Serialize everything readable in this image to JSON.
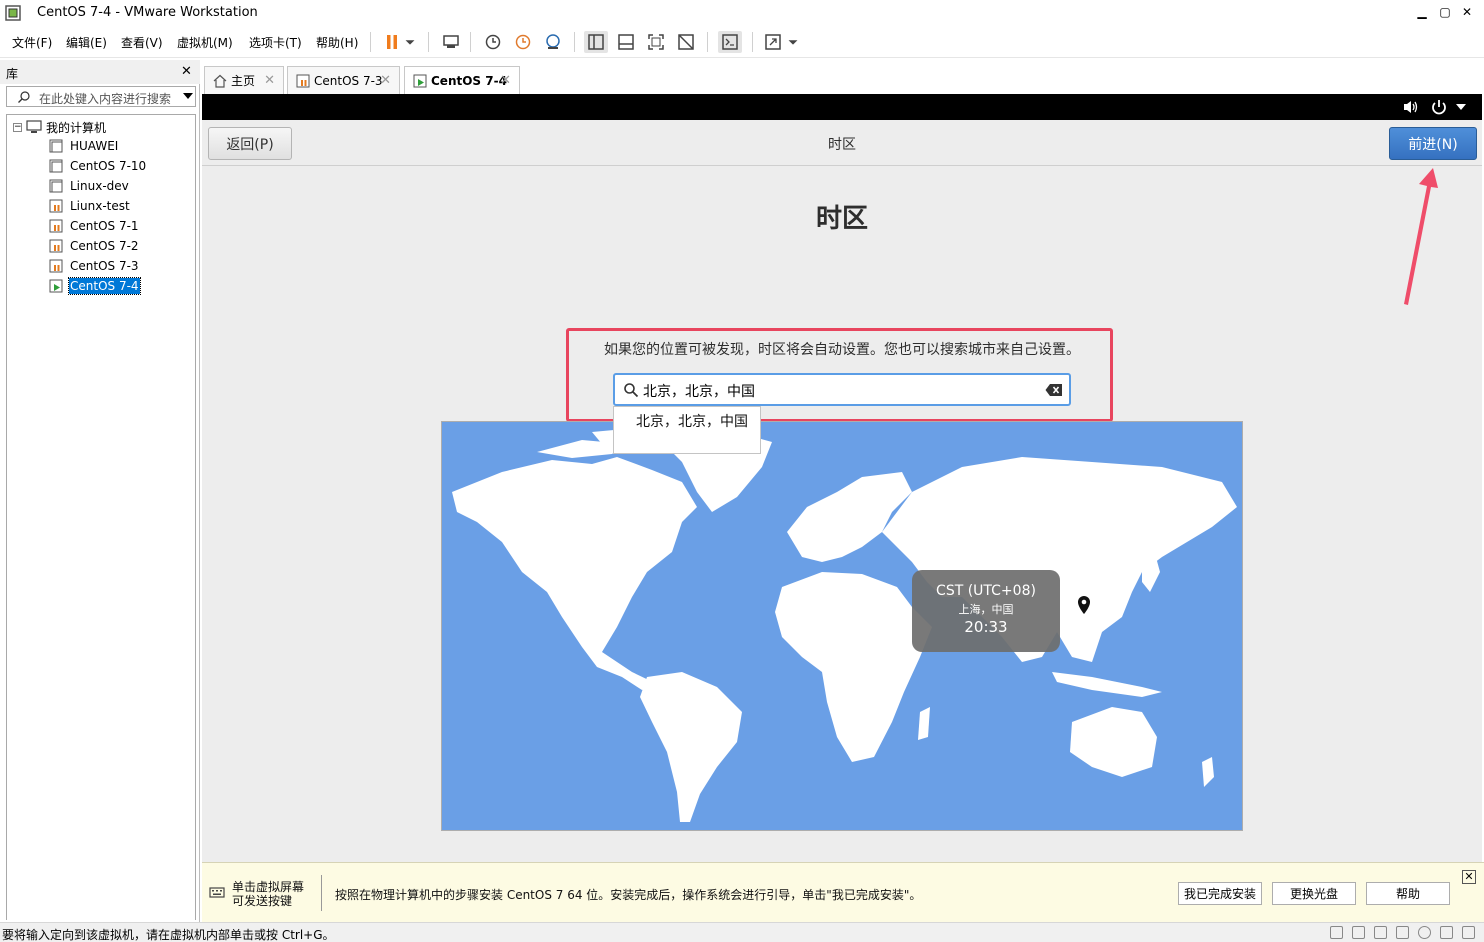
{
  "window": {
    "title": "CentOS 7-4 - VMware Workstation",
    "minimize": "▁",
    "maximize": "▢",
    "close": "✕"
  },
  "menu": [
    "文件(F)",
    "编辑(E)",
    "查看(V)",
    "虚拟机(M)",
    "选项卡(T)",
    "帮助(H)"
  ],
  "toolbar_icons": [
    "pause-icon",
    "dropdown-icon",
    "send-ctrl-alt-del-icon",
    "snapshot-icon",
    "revert-snapshot-icon",
    "snapshot-manager-icon",
    "sidebar-view-icon",
    "thumbnail-view-icon",
    "fullscreen-icon",
    "unity-icon",
    "console-icon",
    "stretch-icon"
  ],
  "library": {
    "title": "库",
    "close": "✕",
    "search_placeholder": "在此处键入内容进行搜索",
    "root": "我的计算机",
    "items": [
      "HUAWEI",
      "CentOS 7-10",
      "Linux-dev",
      "Liunx-test",
      "CentOS 7-1",
      "CentOS 7-2",
      "CentOS 7-3",
      "CentOS 7-4"
    ],
    "selected": "CentOS 7-4"
  },
  "tabs": [
    {
      "label": "主页",
      "close": "✕"
    },
    {
      "label": "CentOS 7-3",
      "close": "✕"
    },
    {
      "label": "CentOS 7-4",
      "close": "✕"
    }
  ],
  "installer": {
    "back": "返回(P)",
    "header_title": "时区",
    "next": "前进(N)",
    "page_title": "时区",
    "hint": "如果您的位置可被发现，时区将会自动设置。您也可以搜索城市来自己设置。",
    "search_value": "北京，北京，中国",
    "suggestion": "北京，北京，中国",
    "tooltip": {
      "tz": "CST (UTC+08)",
      "city": "上海，中国",
      "time": "20:33"
    },
    "colors": {
      "accent": "#3d7dcb",
      "highlight": "#e8455e",
      "ocean": "#6a9fe6"
    }
  },
  "infobar": {
    "click_hint": "单击虚拟屏幕\n可发送按键",
    "message": "按照在物理计算机中的步骤安装 CentOS 7 64 位。安装完成后，操作系统会进行引导，单击\"我已完成安装\"。",
    "buttons": [
      "我已完成安装",
      "更换光盘",
      "帮助"
    ],
    "close": "✕"
  },
  "status": "要将输入定向到该虚拟机，请在虚拟机内部单击或按 Ctrl+G。"
}
